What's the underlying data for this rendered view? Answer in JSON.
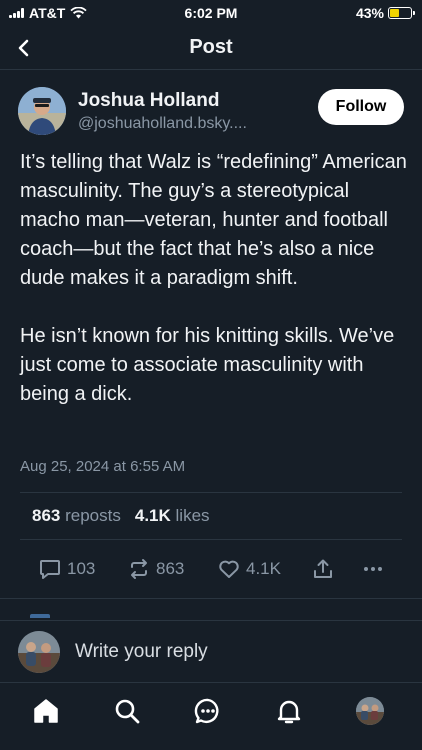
{
  "status_bar": {
    "carrier": "AT&T",
    "time": "6:02 PM",
    "battery_percent": "43%",
    "battery_level": 0.43,
    "battery_color": "#f1d400"
  },
  "header": {
    "back_icon": "chevron-left-icon",
    "title": "Post"
  },
  "post": {
    "author_name": "Joshua Holland",
    "author_handle": "@joshuaholland.bsky....",
    "follow_label": "Follow",
    "paragraphs": [
      "It’s telling that Walz is “redefining” American masculinity. The guy’s a stereotypical macho man—veteran, hunter and football coach—but the fact that he’s also a nice dude makes it a paradigm shift.",
      "He isn’t known for his knitting skills. We’ve just come to associate masculinity with being a dick."
    ],
    "timestamp": "Aug 25, 2024 at 6:55 AM",
    "stats": {
      "reposts_count": "863",
      "reposts_label": "reposts",
      "likes_count": "4.1K",
      "likes_label": "likes"
    },
    "actions": {
      "replies": "103",
      "reposts": "863",
      "likes": "4.1K"
    }
  },
  "reply": {
    "placeholder": "Write your reply"
  },
  "tabbar": {
    "items": [
      "home-icon",
      "search-icon",
      "chat-icon",
      "bell-icon",
      "profile-avatar"
    ]
  },
  "colors": {
    "background": "#161e27",
    "muted_text": "#8a97a5",
    "divider": "#2a3540"
  }
}
